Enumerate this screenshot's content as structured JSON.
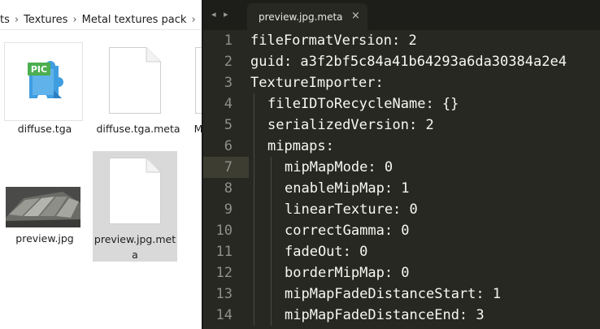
{
  "explorer": {
    "breadcrumb": {
      "items": [
        "ts",
        "Textures",
        "Metal textures pack"
      ],
      "separator": "›"
    },
    "files": [
      {
        "name": "diffuse.tga",
        "icon": "pic-image-icon",
        "badge": "PIC"
      },
      {
        "name": "diffuse.tga.meta",
        "icon": "blank-document-icon"
      },
      {
        "name": "M",
        "icon": "blank-document-icon"
      },
      {
        "name": "preview.jpg",
        "icon": "image-thumbnail-icon"
      },
      {
        "name": "preview.jpg.meta",
        "icon": "blank-document-icon",
        "selected": true
      }
    ]
  },
  "editor": {
    "nav_arrows": "◂ ▸",
    "tab": {
      "title": "preview.jpg.meta",
      "close": "×"
    },
    "current_line": 7,
    "lines": [
      {
        "n": "1",
        "text": "fileFormatVersion: 2",
        "indent": 0
      },
      {
        "n": "2",
        "text": "guid: a3f2bf5c84a41b64293a6da30384a2e4",
        "indent": 0
      },
      {
        "n": "3",
        "text": "TextureImporter:",
        "indent": 0
      },
      {
        "n": "4",
        "text": "fileIDToRecycleName: {}",
        "indent": 1
      },
      {
        "n": "5",
        "text": "serializedVersion: 2",
        "indent": 1
      },
      {
        "n": "6",
        "text": "mipmaps:",
        "indent": 1
      },
      {
        "n": "7",
        "text": "mipMapMode: 0",
        "indent": 2
      },
      {
        "n": "8",
        "text": "enableMipMap: 1",
        "indent": 2
      },
      {
        "n": "9",
        "text": "linearTexture: 0",
        "indent": 2
      },
      {
        "n": "10",
        "text": "correctGamma: 0",
        "indent": 2
      },
      {
        "n": "11",
        "text": "fadeOut: 0",
        "indent": 2
      },
      {
        "n": "12",
        "text": "borderMipMap: 0",
        "indent": 2
      },
      {
        "n": "13",
        "text": "mipMapFadeDistanceStart: 1",
        "indent": 2
      },
      {
        "n": "14",
        "text": "mipMapFadeDistanceEnd: 3",
        "indent": 2
      }
    ]
  },
  "colors": {
    "editor_bg": "#272822",
    "tabbar_bg": "#1d1e19",
    "code_text": "#f8f8f2",
    "line_number": "#90908a",
    "pic_icon_green": "#3fa33f",
    "selection": "#d9d9d9"
  }
}
